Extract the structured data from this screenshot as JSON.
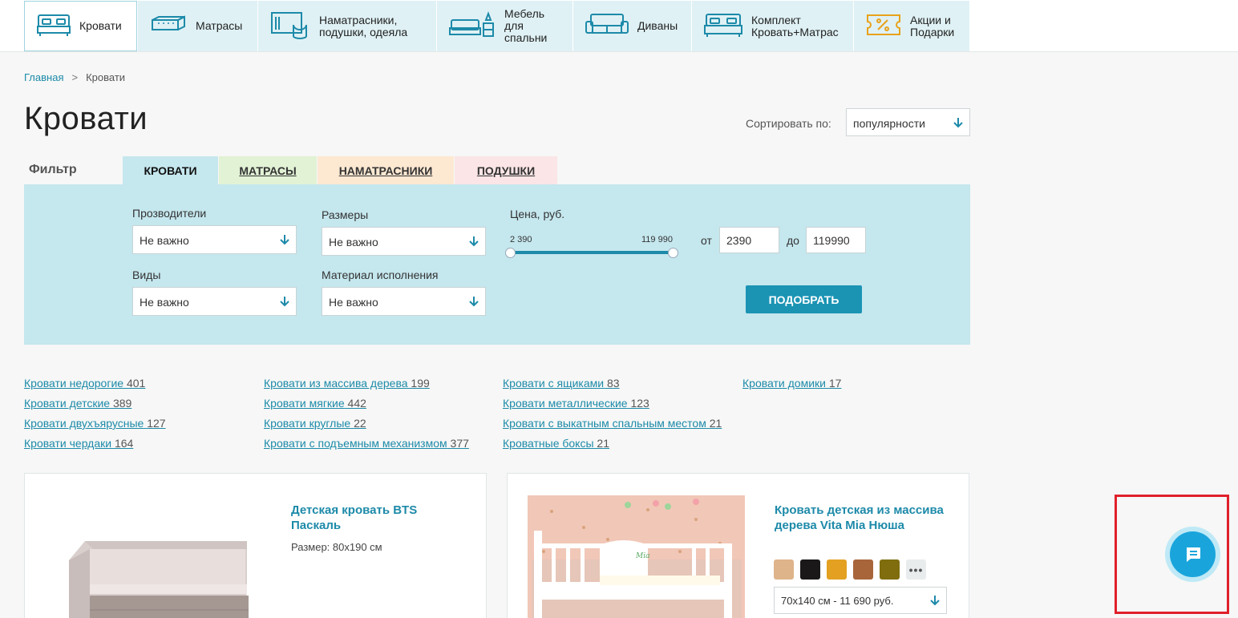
{
  "nav": {
    "items": [
      {
        "label": "Кровати",
        "icon": "bed-icon",
        "active": true
      },
      {
        "label": "Матрасы",
        "icon": "mattress-icon"
      },
      {
        "label": "Наматрасники,\nподушки, одеяла",
        "icon": "pillow-icon"
      },
      {
        "label": "Мебель\nдля\nспальни",
        "icon": "bedroom-furniture-icon"
      },
      {
        "label": "Диваны",
        "icon": "sofa-icon"
      },
      {
        "label": "Комплект\nКровать+Матрас",
        "icon": "bed-mattress-set-icon"
      },
      {
        "label": "Акции и\nПодарки",
        "icon": "sale-ticket-icon"
      }
    ]
  },
  "breadcrumb": {
    "home": "Главная",
    "separator": ">",
    "current": "Кровати"
  },
  "page_title": "Кровати",
  "sort": {
    "label": "Сортировать по:",
    "value": "популярности"
  },
  "filter": {
    "label": "Фильтр",
    "tabs": [
      {
        "label": "КРОВАТИ",
        "color": "#c5e7ee"
      },
      {
        "label": "МАТРАСЫ",
        "color": "#e2f2d5"
      },
      {
        "label": "НАМАТРАСНИКИ",
        "color": "#fde8d2"
      },
      {
        "label": "ПОДУШКИ",
        "color": "#fbe5e6"
      }
    ],
    "manufacturers": {
      "label": "Прозводители",
      "value": "Не важно"
    },
    "sizes": {
      "label": "Размеры",
      "value": "Не важно"
    },
    "types": {
      "label": "Виды",
      "value": "Не важно"
    },
    "material": {
      "label": "Материал исполнения",
      "value": "Не важно"
    },
    "price": {
      "label": "Цена, руб.",
      "min_text": "2 390",
      "max_text": "119 990",
      "from_label": "от",
      "from_value": "2390",
      "to_label": "до",
      "to_value": "119990",
      "range_fraction": [
        0.0,
        1.0
      ]
    },
    "submit_label": "ПОДОБРАТЬ"
  },
  "categories": [
    {
      "name": "Кровати недорогие",
      "count": "401"
    },
    {
      "name": "Кровати детские",
      "count": "389"
    },
    {
      "name": "Кровати двухъярусные",
      "count": "127"
    },
    {
      "name": "Кровати чердаки",
      "count": "164"
    },
    {
      "name": "Кровати из массива дерева",
      "count": "199"
    },
    {
      "name": "Кровати мягкие",
      "count": "442"
    },
    {
      "name": "Кровати круглые",
      "count": "22"
    },
    {
      "name": "Кровати с подъемным механизмом",
      "count": "377"
    },
    {
      "name": "Кровати с ящиками",
      "count": "83"
    },
    {
      "name": "Кровати металлические",
      "count": "123"
    },
    {
      "name": "Кровати с выкатным спальным местом",
      "count": "21"
    },
    {
      "name": "Кроватные боксы",
      "count": "21"
    },
    {
      "name": "Кровати домики",
      "count": "17"
    }
  ],
  "products": [
    {
      "title": "Детская кровать BTS\nПаскаль",
      "size": "Размер: 80x190 см"
    },
    {
      "title": "Кровать детская из массива\nдерева Vita Mia Нюша",
      "swatches": [
        "#deb48a",
        "#1a1818",
        "#e3a021",
        "#a8653a",
        "#7f6d0e"
      ],
      "more": "•••",
      "variant": "70x140 см - 11 690 руб."
    }
  ],
  "chat": {
    "icon": "chat-icon"
  }
}
